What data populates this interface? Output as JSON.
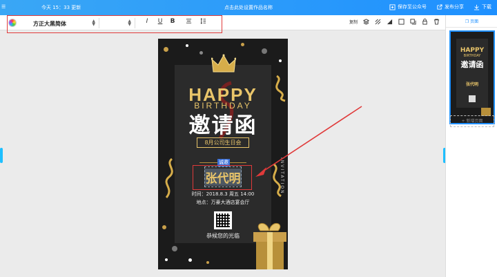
{
  "topbar": {
    "left_glyph": "☰",
    "save_time": "今天 15：33 更新",
    "title_prompt": "点击此处设置作品名称",
    "actions": [
      {
        "label": "保存至公众号",
        "icon": "share-box-icon"
      },
      {
        "label": "发布分享",
        "icon": "external-share-icon"
      },
      {
        "label": "下载",
        "icon": "download-icon"
      }
    ]
  },
  "toolbar": {
    "font_family": "方正大黑简体",
    "font_size": "",
    "format_buttons": [
      "I",
      "U",
      "B"
    ],
    "right_copy_label": "复制"
  },
  "right_panel": {
    "tab_label": "页面",
    "add_page_label": "+ 新增页面"
  },
  "invitation": {
    "happy": "HAPPY",
    "birthday": "BIRTHDAY",
    "main_title": "邀请函",
    "event": "8月公司生日会",
    "sincerely": "诚邀",
    "name": "张代明",
    "vertical_text": "INVITATION",
    "time_line": "时间：2018.8.3 周五 14:00",
    "place_line": "地点：万豪大酒店宴会厅",
    "closing": "恭候您的光临"
  },
  "colors": {
    "accent_blue": "#1e90ff",
    "highlight_red": "#e03a3a",
    "gold": "#e9c56a"
  }
}
